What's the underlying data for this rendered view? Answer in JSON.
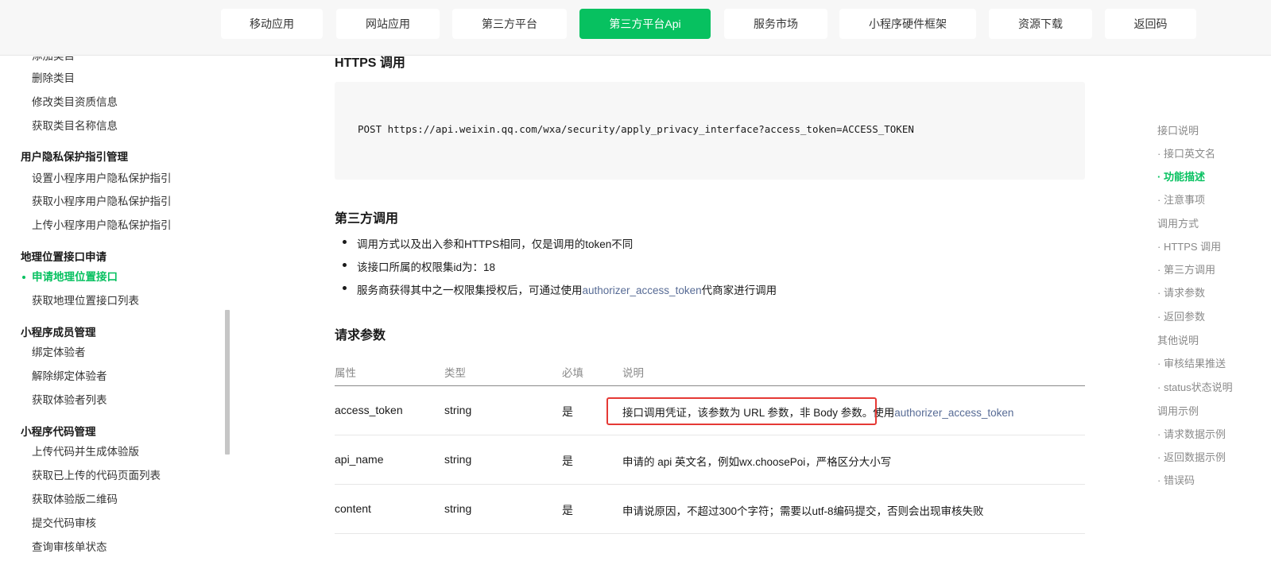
{
  "nav": {
    "tabs": [
      {
        "label": "移动应用"
      },
      {
        "label": "网站应用"
      },
      {
        "label": "第三方平台"
      },
      {
        "label": "第三方平台Api"
      },
      {
        "label": "服务市场"
      },
      {
        "label": "小程序硬件框架"
      },
      {
        "label": "资源下载"
      },
      {
        "label": "返回码"
      }
    ]
  },
  "sidebar": {
    "items": [
      {
        "label": "添加类目"
      },
      {
        "label": "删除类目"
      },
      {
        "label": "修改类目资质信息"
      },
      {
        "label": "获取类目名称信息"
      },
      {
        "label": "用户隐私保护指引管理"
      },
      {
        "label": "设置小程序用户隐私保护指引"
      },
      {
        "label": "获取小程序用户隐私保护指引"
      },
      {
        "label": "上传小程序用户隐私保护指引"
      },
      {
        "label": "地理位置接口申请"
      },
      {
        "label": "申请地理位置接口"
      },
      {
        "label": "获取地理位置接口列表"
      },
      {
        "label": "小程序成员管理"
      },
      {
        "label": "绑定体验者"
      },
      {
        "label": "解除绑定体验者"
      },
      {
        "label": "获取体验者列表"
      },
      {
        "label": "小程序代码管理"
      },
      {
        "label": "上传代码并生成体验版"
      },
      {
        "label": "获取已上传的代码页面列表"
      },
      {
        "label": "获取体验版二维码"
      },
      {
        "label": "提交代码审核"
      },
      {
        "label": "查询审核单状态"
      }
    ]
  },
  "main": {
    "https_title": "HTTPS 调用",
    "code": "POST https://api.weixin.qq.com/wxa/security/apply_privacy_interface?access_token=ACCESS_TOKEN",
    "third_title": "第三方调用",
    "bullets": {
      "b1": "调用方式以及出入参和HTTPS相同，仅是调用的token不同",
      "b2": "该接口所属的权限集id为：18",
      "b3_pre": "服务商获得其中之一权限集授权后，可通过使用",
      "b3_link": "authorizer_access_token",
      "b3_post": "代商家进行调用"
    },
    "params_title": "请求参数",
    "table": {
      "headers": {
        "name": "属性",
        "type": "类型",
        "required": "必填",
        "desc": "说明"
      },
      "rows": [
        {
          "name": "access_token",
          "type": "string",
          "required": "是",
          "desc": "接口调用凭证，该参数为 URL 参数，非 Body 参数。",
          "desc_suffix": "使用",
          "desc_link": "authorizer_access_token"
        },
        {
          "name": "api_name",
          "type": "string",
          "required": "是",
          "desc": "申请的 api 英文名，例如wx.choosePoi，严格区分大小写"
        },
        {
          "name": "content",
          "type": "string",
          "required": "是",
          "desc": "申请说原因，不超过300个字符；需要以utf-8编码提交，否则会出现审核失败"
        }
      ]
    }
  },
  "toc": {
    "items": [
      {
        "label": "接口说明"
      },
      {
        "label": "· 接口英文名"
      },
      {
        "label": "· 功能描述"
      },
      {
        "label": "· 注意事项"
      },
      {
        "label": "调用方式"
      },
      {
        "label": "· HTTPS 调用"
      },
      {
        "label": "· 第三方调用"
      },
      {
        "label": "· 请求参数"
      },
      {
        "label": "· 返回参数"
      },
      {
        "label": "其他说明"
      },
      {
        "label": "· 审核结果推送"
      },
      {
        "label": "· status状态说明"
      },
      {
        "label": "调用示例"
      },
      {
        "label": "· 请求数据示例"
      },
      {
        "label": "· 返回数据示例"
      },
      {
        "label": "· 错误码"
      }
    ]
  },
  "colors": {
    "accent": "#07c160",
    "link": "#576b95",
    "highlight_border": "#e53935"
  }
}
